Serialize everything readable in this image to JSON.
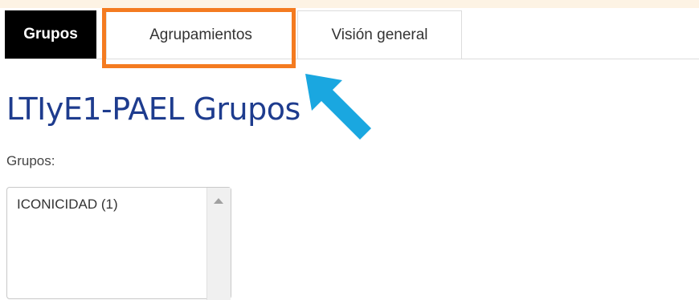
{
  "tabs": [
    {
      "label": "Grupos",
      "active": true
    },
    {
      "label": "Agrupamientos",
      "highlighted": true
    },
    {
      "label": "Visión general"
    }
  ],
  "page": {
    "title": "LTIyE1-PAEL Grupos",
    "groups_label": "Grupos:"
  },
  "groups_list": {
    "options": [
      "ICONICIDAD (1)"
    ]
  },
  "colors": {
    "active_tab": "#000000",
    "highlight": "#f47b20",
    "arrow": "#1aa7e0",
    "title": "#1e3c8e"
  },
  "icons": {
    "callout_arrow": "arrow-icon",
    "scroll_up": "scroll-up-icon"
  }
}
